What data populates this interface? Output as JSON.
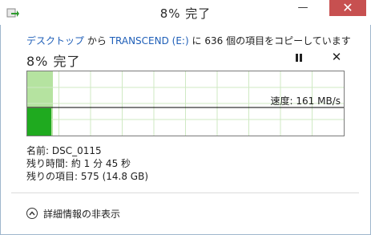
{
  "window": {
    "title": "8% 完了",
    "minimize_glyph": "—",
    "close_glyph": "✕",
    "icons": {
      "app": "copy-arrow-icon",
      "minimize": "minimize-icon",
      "close": "close-icon"
    }
  },
  "copy": {
    "source": "デスクトップ",
    "from_label": "から",
    "destination": "TRANSCEND (E:)",
    "to_label": "に",
    "count": "636",
    "count_suffix": "個の項目をコピーしています"
  },
  "progress": {
    "title": "8% 完了",
    "percent": 8,
    "cancel_glyph": "✕",
    "icons": {
      "pause": "pause-icon",
      "cancel": "cancel-icon"
    }
  },
  "graph": {
    "speed_text": "速度: 161 MB/s",
    "colors": {
      "completed": "#b5e3a0",
      "speed_fill": "#1faa1f",
      "grid": "#cfe9c3",
      "line": "#000000"
    }
  },
  "details": {
    "name": "名前: DSC_0115",
    "time_remaining": "残り時間: 約 1 分 45 秒",
    "items_remaining": "残りの項目: 575 (14.8 GB)"
  },
  "footer": {
    "toggle_label": "詳細情報の非表示",
    "icon": "chevron-up-circle-icon"
  }
}
